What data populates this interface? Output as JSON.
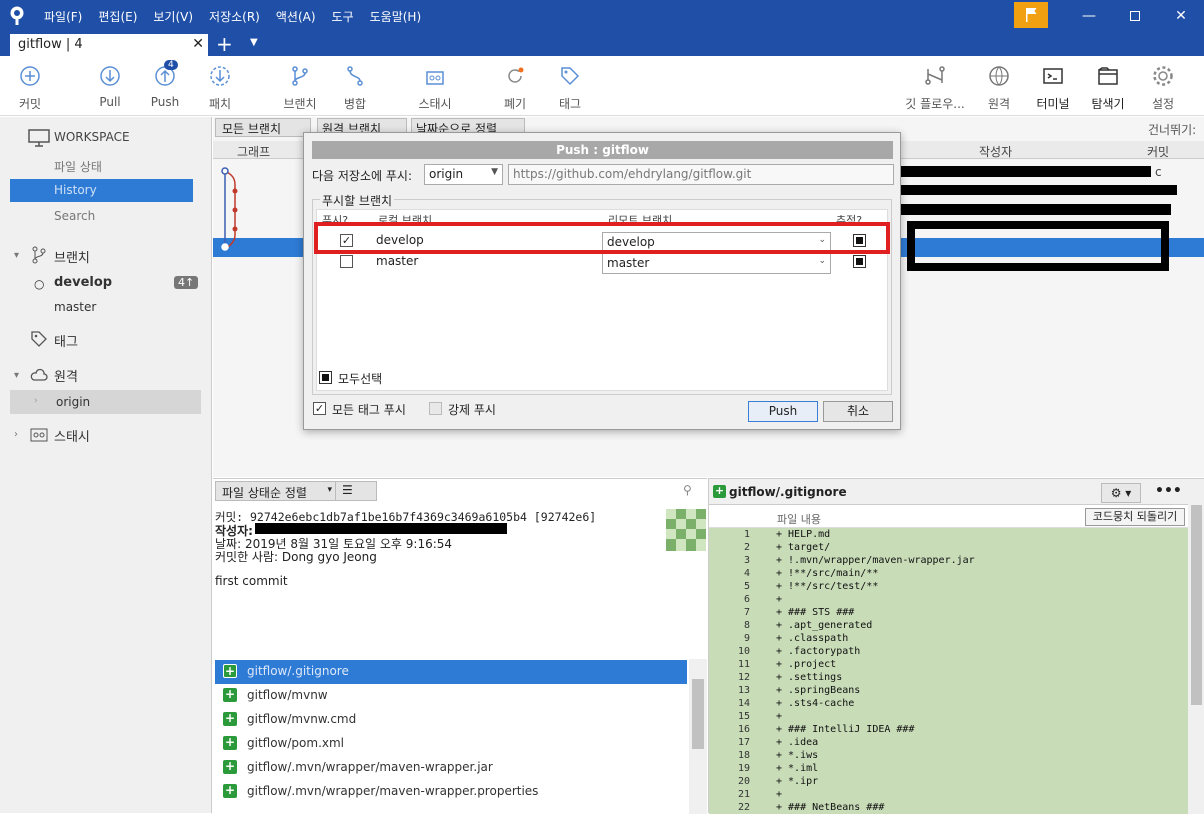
{
  "app": {
    "menu": [
      "파일(F)",
      "편집(E)",
      "보기(V)",
      "저장소(R)",
      "액션(A)",
      "도구",
      "도움말(H)"
    ],
    "tab_title": "gitflow | 4",
    "tab_plus": "+"
  },
  "toolbar": {
    "commit": "커밋",
    "pull": "Pull",
    "push": "Push",
    "push_badge": "4",
    "fetch": "패치",
    "branch": "브랜치",
    "merge": "병합",
    "stash": "스태시",
    "discard": "폐기",
    "tag": "태그",
    "gitflow": "깃 플로우...",
    "remote": "원격",
    "terminal": "터미널",
    "explorer": "탐색기",
    "settings": "설정"
  },
  "sidebar": {
    "workspace": "WORKSPACE",
    "file_status": "파일 상태",
    "history": "History",
    "search": "Search",
    "branches": "브랜치",
    "branch_develop": "develop",
    "branch_develop_badge": "4↑",
    "branch_master": "master",
    "tags": "태그",
    "remotes": "원격",
    "remote_origin": "origin",
    "stashes": "스태시"
  },
  "history": {
    "filter_branches": "모든 브랜치",
    "remote_branch": "원격 브랜치",
    "sort": "날짜순으로 정렬",
    "skip": "건너뛰기:",
    "col_graph": "그래프",
    "col_author": "작성자",
    "col_commit": "커밋",
    "commit_partial": "c"
  },
  "dialog": {
    "title": "Push : gitflow",
    "push_to_label": "다음 저장소에 푸시:",
    "remote_select": "origin",
    "remote_url": "https://github.com/ehdrylang/gitflow.git",
    "branches_group": "푸시할 브랜치",
    "col_push": "푸시?",
    "col_local": "로컬 브랜치",
    "col_remote": "리모트 브랜치",
    "col_track": "추적?",
    "rows": [
      {
        "checked": true,
        "local": "develop",
        "remote": "develop",
        "track": true
      },
      {
        "checked": false,
        "local": "master",
        "remote": "master",
        "track": true
      }
    ],
    "select_all": "모두선택",
    "push_all_tags": "모든 태그 푸시",
    "force_push": "강제 푸시",
    "push_button": "Push",
    "cancel_button": "취소"
  },
  "detail": {
    "sort_files": "파일 상태순 정렬",
    "commit_line": "커밋: 92742e6ebc1db7af1be16b7f4369c3469a6105b4 [92742e6]",
    "author_label": "작성자:",
    "date_line": "날짜: 2019년 8월 31일 토요일 오후 9:16:54",
    "committer_line": "커밋한 사람: Dong gyo Jeong",
    "message": "first commit",
    "files": [
      "gitflow/.gitignore",
      "gitflow/mvnw",
      "gitflow/mvnw.cmd",
      "gitflow/pom.xml",
      "gitflow/.mvn/wrapper/maven-wrapper.jar",
      "gitflow/.mvn/wrapper/maven-wrapper.properties"
    ]
  },
  "diff": {
    "file_title": "gitflow/.gitignore",
    "content_label": "파일 내용",
    "revert_hunk": "코드뭉치 되돌리기",
    "lines": [
      {
        "n": "1",
        "t": "+ HELP.md"
      },
      {
        "n": "2",
        "t": "+ target/"
      },
      {
        "n": "3",
        "t": "+ !.mvn/wrapper/maven-wrapper.jar"
      },
      {
        "n": "4",
        "t": "+ !**/src/main/**"
      },
      {
        "n": "5",
        "t": "+ !**/src/test/**"
      },
      {
        "n": "6",
        "t": "+"
      },
      {
        "n": "7",
        "t": "+ ### STS ###"
      },
      {
        "n": "8",
        "t": "+ .apt_generated"
      },
      {
        "n": "9",
        "t": "+ .classpath"
      },
      {
        "n": "10",
        "t": "+ .factorypath"
      },
      {
        "n": "11",
        "t": "+ .project"
      },
      {
        "n": "12",
        "t": "+ .settings"
      },
      {
        "n": "13",
        "t": "+ .springBeans"
      },
      {
        "n": "14",
        "t": "+ .sts4-cache"
      },
      {
        "n": "15",
        "t": "+"
      },
      {
        "n": "16",
        "t": "+ ### IntelliJ IDEA ###"
      },
      {
        "n": "17",
        "t": "+ .idea"
      },
      {
        "n": "18",
        "t": "+ *.iws"
      },
      {
        "n": "19",
        "t": "+ *.iml"
      },
      {
        "n": "20",
        "t": "+ *.ipr"
      },
      {
        "n": "21",
        "t": "+"
      },
      {
        "n": "22",
        "t": "+ ### NetBeans ###"
      }
    ]
  },
  "colors": {
    "titlebar": "#1f4fa6",
    "selection": "#2e7bd6",
    "highlight_red": "#e02020",
    "diff_green": "#c8dcb8"
  }
}
